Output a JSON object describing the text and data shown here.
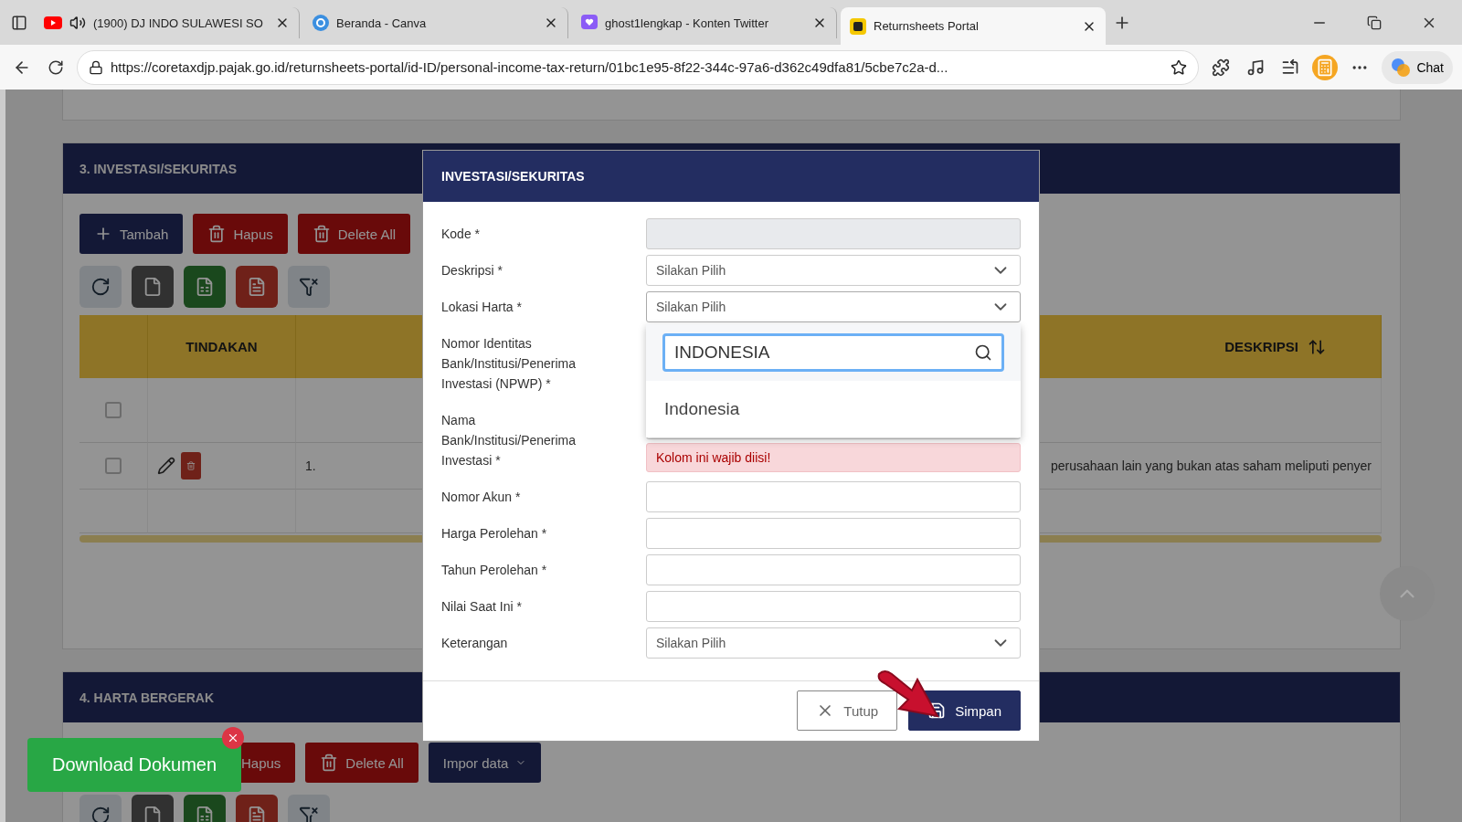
{
  "browser": {
    "tabs": [
      {
        "title": "(1900) DJ INDO SULAWESI SO",
        "selected": false
      },
      {
        "title": "Beranda - Canva",
        "selected": false
      },
      {
        "title": "ghost1lengkap - Konten Twitter",
        "selected": false
      },
      {
        "title": "Returnsheets Portal",
        "selected": true
      }
    ],
    "url": "https://coretaxdjp.pajak.go.id/returnsheets-portal/id-ID/personal-income-tax-return/01bc1e95-8f22-344c-97a6-d362c49dfa81/5cbe7c2a-d...",
    "chat": "Chat"
  },
  "sections": [
    {
      "title": "3. INVESTASI/SEKURITAS",
      "buttons": [
        {
          "label": "Tambah",
          "kind": "add"
        },
        {
          "label": "Hapus",
          "kind": "delete"
        },
        {
          "label": "Delete All",
          "kind": "delete"
        }
      ],
      "table": {
        "columns": [
          "TINDAKAN",
          "DESKRIPSI"
        ],
        "rows": [
          {
            "checked": false,
            "actions": false,
            "number": "",
            "description": ""
          },
          {
            "checked": false,
            "actions": true,
            "number": "1.",
            "description": "perusahaan lain yang bukan atas saham meliputi penyer"
          }
        ]
      }
    },
    {
      "title": "4. HARTA BERGERAK",
      "buttons": [
        {
          "label": "Hapus",
          "kind": "delete"
        },
        {
          "label": "Delete All",
          "kind": "delete"
        },
        {
          "label": "Impor data",
          "kind": "menu"
        }
      ]
    }
  ],
  "modal": {
    "title": "INVESTASI/SEKURITAS",
    "fields": [
      {
        "label": "Kode *",
        "kind": "readonly"
      },
      {
        "label": "Deskripsi *",
        "kind": "select",
        "placeholder": "Silakan Pilih",
        "expanded": false
      },
      {
        "label": "Lokasi Harta *",
        "kind": "select",
        "placeholder": "Silakan Pilih",
        "expanded": true,
        "dropdown": {
          "search": "INDONESIA",
          "options": [
            {
              "label": "Indonesia",
              "selected": false
            }
          ]
        }
      },
      {
        "label": "Nomor Identitas Bank/Institusi/Penerima Investasi (NPWP) *",
        "kind": "text"
      },
      {
        "label": "Nama Bank/Institusi/Penerima Investasi *",
        "kind": "text",
        "error": "Kolom ini wajib diisi!"
      },
      {
        "label": "Nomor Akun *",
        "kind": "text"
      },
      {
        "label": "Harga Perolehan *",
        "kind": "text"
      },
      {
        "label": "Tahun Perolehan *",
        "kind": "text"
      },
      {
        "label": "Nilai Saat Ini *",
        "kind": "text"
      },
      {
        "label": "Keterangan",
        "kind": "select",
        "placeholder": "Silakan Pilih",
        "expanded": false
      }
    ],
    "buttons": [
      {
        "label": "Tutup",
        "kind": "close"
      },
      {
        "label": "Simpan",
        "kind": "save"
      }
    ]
  },
  "download_button": "Download Dokumen"
}
